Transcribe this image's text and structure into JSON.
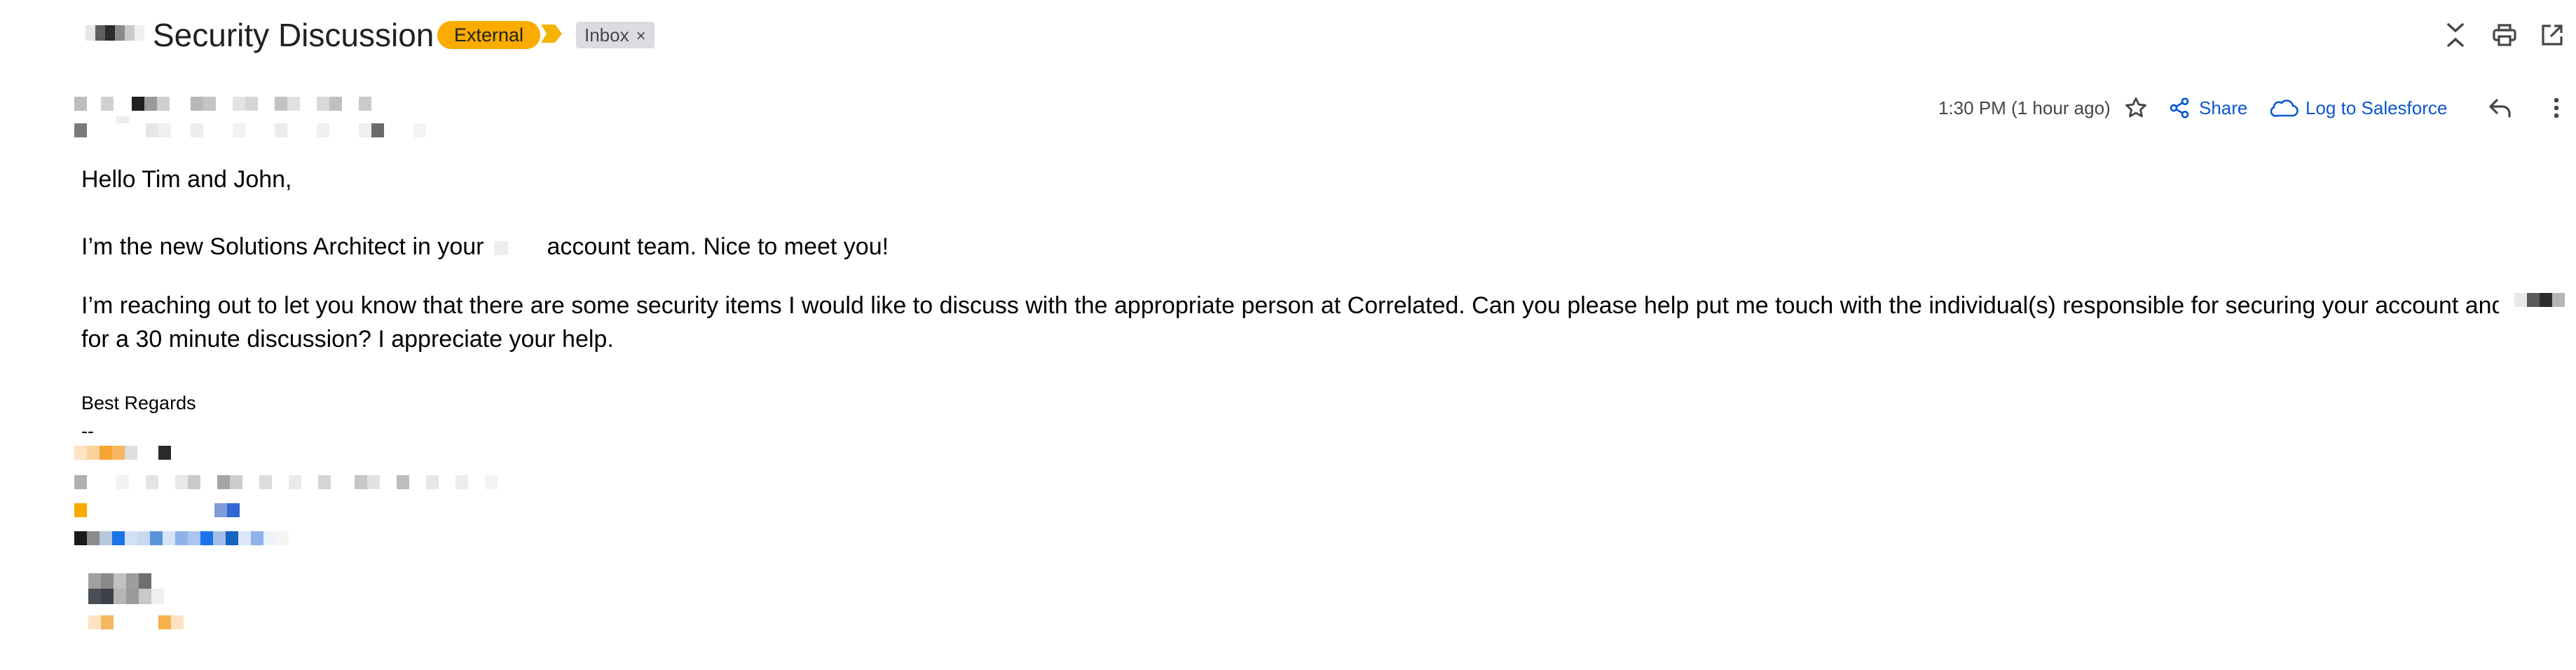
{
  "header": {
    "subject": "Security Discussion",
    "labels": {
      "external": "External",
      "inbox": "Inbox",
      "inbox_remove": "×"
    }
  },
  "message": {
    "time": "1:30 PM (1 hour ago)",
    "actions": {
      "share": "Share",
      "log_to_salesforce": "Log to Salesforce"
    },
    "body": {
      "greeting": "Hello Tim and John,",
      "line1_prefix": "I’m the new Solutions Architect in your",
      "line1_suffix": "account team. Nice to meet you!",
      "line2": "I’m reaching out to let you know that there are some security items I would like to discuss with the appropriate person at Correlated.  Can you please help put me touch with the individual(s) responsible for securing your account and workloads o",
      "line3": "for a 30 minute discussion?  I appreciate your help.",
      "signoff": "Best Regards",
      "dashes": "--"
    }
  },
  "colors": {
    "accent_link": "#0b57d0",
    "label_external": "#f9ab00",
    "label_inbox": "#dadce0"
  },
  "icons": [
    "collapse-icon",
    "print-icon",
    "open-in-new-icon",
    "star-icon",
    "share-icon",
    "salesforce-cloud-icon",
    "reply-icon",
    "more-vert-icon",
    "importance-marker-icon"
  ]
}
